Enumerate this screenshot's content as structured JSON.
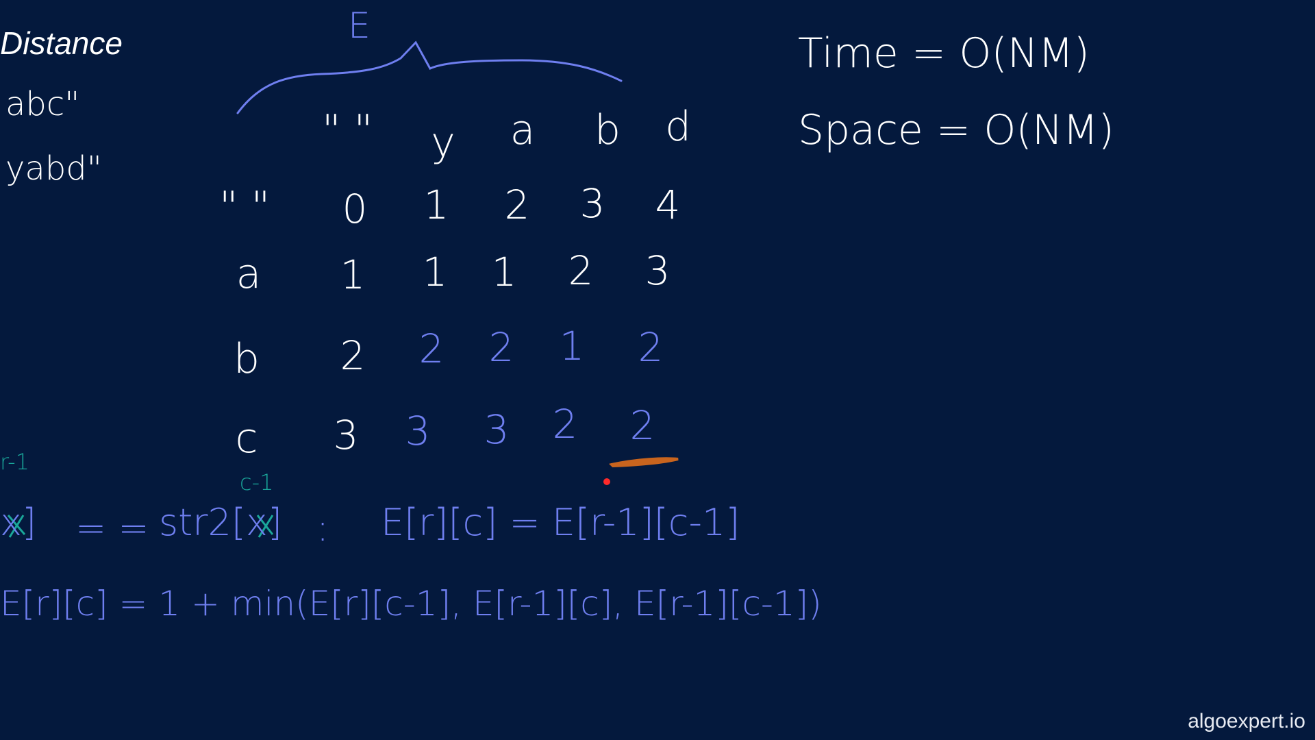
{
  "title": "Distance",
  "strings": {
    "str1": "abc\"",
    "str2": "yabd\""
  },
  "brace_label": "E",
  "complexity": {
    "time": "Time = O(NM)",
    "space": "Space = O(NM)"
  },
  "table": {
    "col_headers": [
      "\" \"",
      "y",
      "a",
      "b",
      "d"
    ],
    "row_headers": [
      "\" \"",
      "a",
      "b",
      "c"
    ],
    "rows": [
      [
        "0",
        "1",
        "2",
        "3",
        "4"
      ],
      [
        "1",
        "1",
        "1",
        "2",
        "3"
      ],
      [
        "2",
        "2",
        "2",
        "1",
        "2"
      ],
      [
        "3",
        "3",
        "3",
        "2",
        "2"
      ]
    ]
  },
  "annotations": {
    "r_minus_1": "r-1",
    "c_minus_1": "c-1"
  },
  "formulas": {
    "condition_left": "x]",
    "condition_eq": "= =",
    "condition_str2": "str2[x]",
    "condition_colon": ":",
    "match_case": "E[r][c] = E[r-1][c-1]",
    "else_case": "E[r][c] = 1 + min(E[r][c-1], E[r-1][c], E[r-1][c-1])"
  },
  "colors": {
    "background": "#04193d",
    "ink_white": "#ffffff",
    "ink_blue": "#6f7ff0",
    "ink_teal": "#1aa79a",
    "ink_orange": "#c8641e",
    "pointer_red": "#ff2a2a"
  },
  "watermark": "algoexpert.io"
}
